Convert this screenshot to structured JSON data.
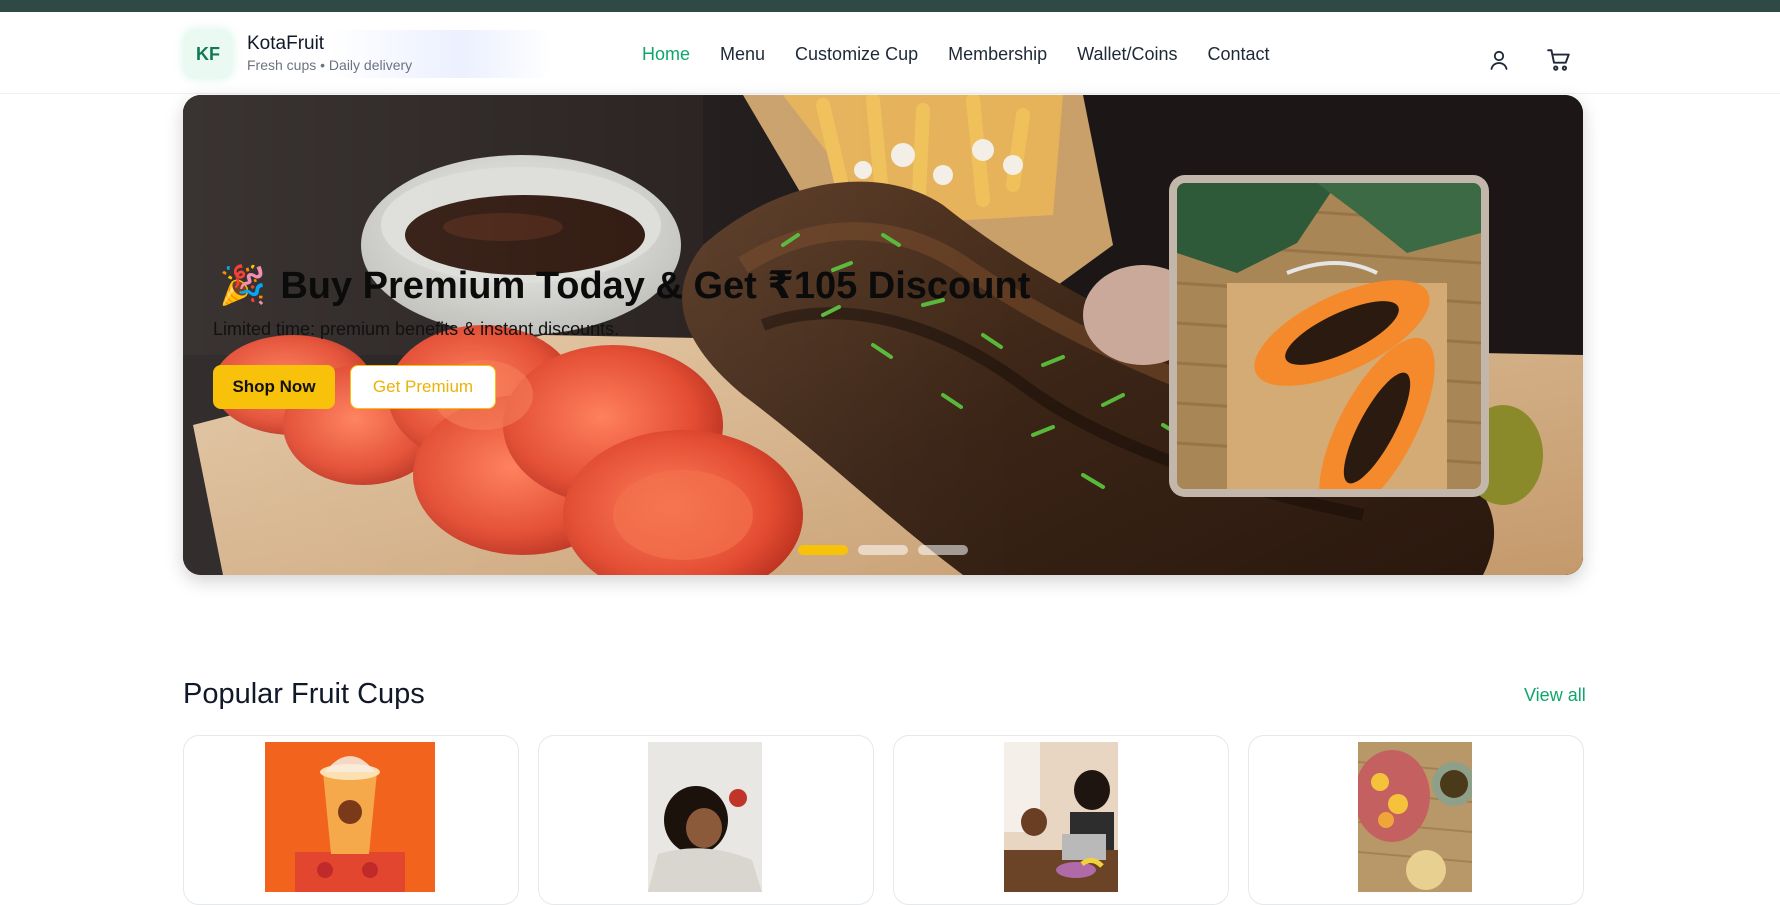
{
  "brand": {
    "logo_text": "KF",
    "name": "KotaFruit",
    "tagline": "Fresh cups • Daily delivery"
  },
  "nav": {
    "items": [
      {
        "label": "Home",
        "active": true
      },
      {
        "label": "Menu"
      },
      {
        "label": "Customize Cup"
      },
      {
        "label": "Membership"
      },
      {
        "label": "Wallet/Coins"
      },
      {
        "label": "Contact"
      }
    ],
    "icons": [
      "user-icon",
      "cart-icon"
    ]
  },
  "hero": {
    "emoji": "🎉",
    "title": "Buy Premium Today & Get ₹105 Discount",
    "subtitle": "Limited time: premium benefits & instant discounts.",
    "primary_button": "Shop Now",
    "secondary_button": "Get Premium",
    "slides": 3,
    "active_slide": 1
  },
  "popular": {
    "title": "Popular Fruit Cups",
    "view_all": "View all",
    "cards": [
      {
        "image": "fruit-cup-photo"
      },
      {
        "image": "woman-eating-apple-photo"
      },
      {
        "image": "family-table-photo"
      },
      {
        "image": "fruit-plate-tea-photo"
      }
    ]
  },
  "colors": {
    "accent_green": "#10a66b",
    "accent_yellow": "#f9c20a",
    "topbar": "#2f4a44"
  }
}
